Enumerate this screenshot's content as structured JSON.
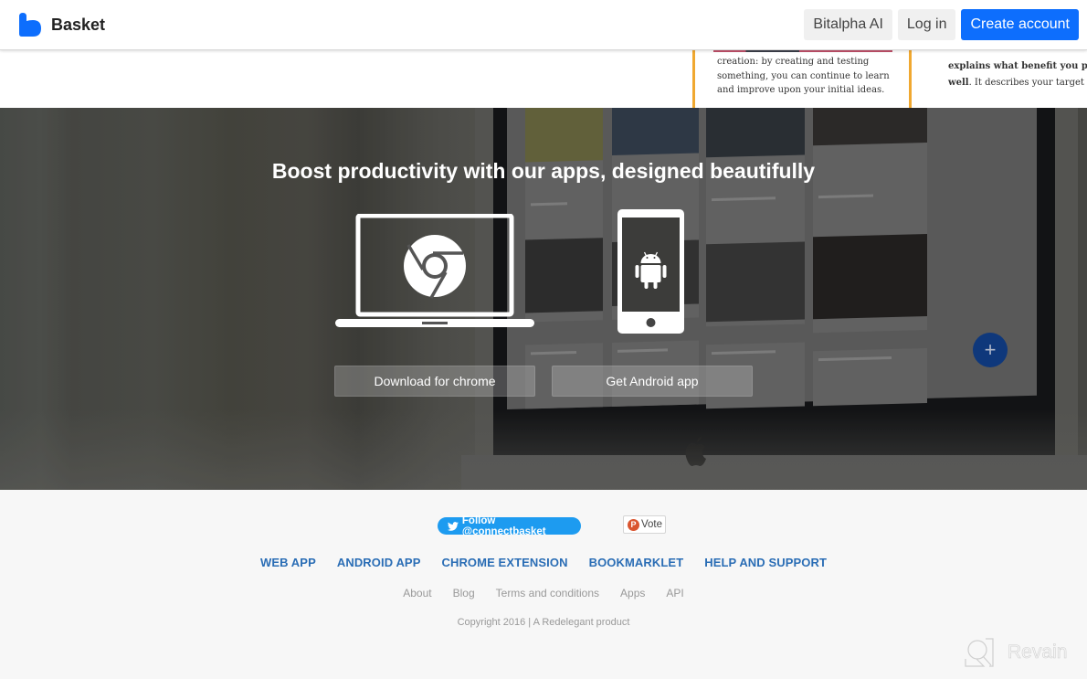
{
  "header": {
    "brand": "Basket",
    "brand_color": "#0d6efd",
    "nav": {
      "bitalpha": "Bitalpha AI",
      "login": "Log in",
      "create_account": "Create account"
    }
  },
  "background_doc": {
    "card_text": "creation: by creating and testing something, you can continue to learn and improve upon your initial ideas.",
    "right_bold_1": "explains what benefit you provi",
    "right_bold_2": "well",
    "right_text_2": ". It describes your target buye"
  },
  "hero": {
    "title": "Boost productivity with our apps, designed beautifully",
    "chrome_button": "Download for chrome",
    "android_button": "Get Android app",
    "fab_label": "+"
  },
  "footer": {
    "twitter_button": "Follow @connectbasket",
    "vote_button": "Vote",
    "vote_badge": "P",
    "nav": [
      "WEB APP",
      "ANDROID APP",
      "CHROME EXTENSION",
      "BOOKMARKLET",
      "HELP AND SUPPORT"
    ],
    "links": [
      "About",
      "Blog",
      "Terms and conditions",
      "Apps",
      "API"
    ],
    "copyright": "Copyright 2016 | A Redelegant product",
    "watermark": "Revain"
  },
  "colors": {
    "primary": "#0d6efd",
    "footer_nav": "#2a6db5",
    "twitter": "#1d9bf0",
    "producthunt": "#da552f"
  }
}
